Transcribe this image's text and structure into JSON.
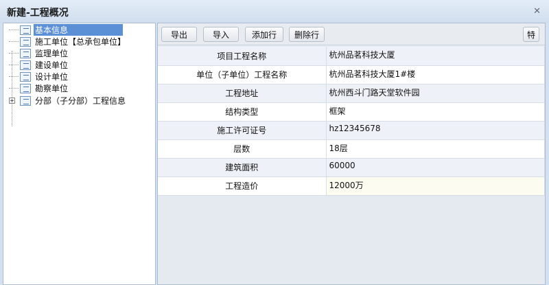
{
  "window": {
    "title": "新建-工程概况",
    "close_icon": "close-icon"
  },
  "tree": {
    "items": [
      {
        "label": "基本信息",
        "selected": true
      },
      {
        "label": "施工单位【总承包单位】"
      },
      {
        "label": "监理单位"
      },
      {
        "label": "建设单位"
      },
      {
        "label": "设计单位"
      },
      {
        "label": "勘察单位"
      },
      {
        "label": "分部（子分部）工程信息",
        "expandable": true
      }
    ],
    "expand_symbol": "+"
  },
  "toolbar": {
    "export": "导出",
    "import": "导入",
    "add_row": "添加行",
    "delete_row": "删除行",
    "special": "特"
  },
  "table": {
    "rows": [
      {
        "key": "项目工程名称",
        "value": "杭州品茗科技大厦"
      },
      {
        "key": "单位（子单位）工程名称",
        "value": "杭州品茗科技大厦1#楼"
      },
      {
        "key": "工程地址",
        "value": "杭州西斗门路天堂软件园"
      },
      {
        "key": "结构类型",
        "value": "框架"
      },
      {
        "key": "施工许可证号",
        "value": "hz12345678"
      },
      {
        "key": "层数",
        "value": "18层"
      },
      {
        "key": "建筑面积",
        "value": "60000"
      },
      {
        "key": "工程造价",
        "value": "12000万"
      }
    ]
  }
}
